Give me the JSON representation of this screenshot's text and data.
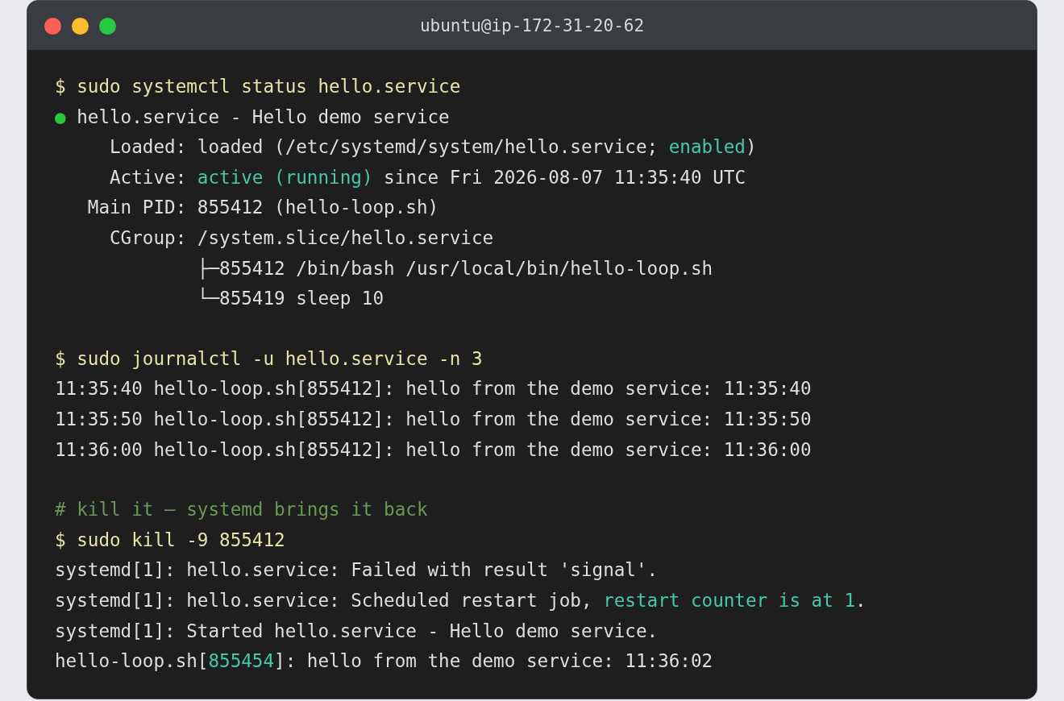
{
  "window": {
    "title": "ubuntu@ip-172-31-20-62",
    "controls": [
      {
        "color": "#ff5f57"
      },
      {
        "color": "#febc2e"
      },
      {
        "color": "#28c840"
      }
    ]
  },
  "blocks": [
    {
      "lines": [
        {
          "segments": [
            {
              "kind": "command",
              "text": "$ sudo systemctl status hello.service"
            }
          ]
        },
        {
          "segments": [
            {
              "kind": "dot",
              "text": "●"
            },
            {
              "kind": "output",
              "text": " hello.service - Hello demo service"
            }
          ]
        },
        {
          "segments": [
            {
              "kind": "output",
              "text": "     Loaded: loaded (/etc/systemd/system/hello.service; "
            },
            {
              "kind": "accent",
              "text": "enabled"
            },
            {
              "kind": "output",
              "text": ")"
            }
          ]
        },
        {
          "segments": [
            {
              "kind": "output",
              "text": "     Active: "
            },
            {
              "kind": "accent",
              "text": "active (running)"
            },
            {
              "kind": "output",
              "text": " since Fri 2026-08-07 11:35:40 UTC"
            }
          ]
        },
        {
          "segments": [
            {
              "kind": "output",
              "text": "   Main PID: 855412 (hello-loop.sh)"
            }
          ]
        },
        {
          "segments": [
            {
              "kind": "output",
              "text": "     CGroup: /system.slice/hello.service"
            }
          ]
        },
        {
          "segments": [
            {
              "kind": "output",
              "text": "             ├─855412 /bin/bash /usr/local/bin/hello-loop.sh"
            }
          ]
        },
        {
          "segments": [
            {
              "kind": "output",
              "text": "             └─855419 sleep 10"
            }
          ]
        }
      ]
    },
    {
      "lines": [
        {
          "segments": [
            {
              "kind": "command",
              "text": "$ sudo journalctl -u hello.service -n 3"
            }
          ]
        },
        {
          "segments": [
            {
              "kind": "output",
              "text": "11:35:40 hello-loop.sh[855412]: hello from the demo service: 11:35:40"
            }
          ]
        },
        {
          "segments": [
            {
              "kind": "output",
              "text": "11:35:50 hello-loop.sh[855412]: hello from the demo service: 11:35:50"
            }
          ]
        },
        {
          "segments": [
            {
              "kind": "output",
              "text": "11:36:00 hello-loop.sh[855412]: hello from the demo service: 11:36:00"
            }
          ]
        }
      ]
    },
    {
      "lines": [
        {
          "segments": [
            {
              "kind": "comment",
              "text": "# kill it — systemd brings it back"
            }
          ]
        },
        {
          "segments": [
            {
              "kind": "command",
              "text": "$ sudo kill -9 855412"
            }
          ]
        },
        {
          "segments": [
            {
              "kind": "output",
              "text": "systemd[1]: hello.service: Failed with result 'signal'."
            }
          ]
        },
        {
          "segments": [
            {
              "kind": "output",
              "text": "systemd[1]: hello.service: Scheduled restart job, "
            },
            {
              "kind": "accent",
              "text": "restart counter is at 1"
            },
            {
              "kind": "output",
              "text": "."
            }
          ]
        },
        {
          "segments": [
            {
              "kind": "output",
              "text": "systemd[1]: Started hello.service - Hello demo service."
            }
          ]
        },
        {
          "segments": [
            {
              "kind": "output",
              "text": "hello-loop.sh["
            },
            {
              "kind": "accent",
              "text": "855454"
            },
            {
              "kind": "output",
              "text": "]: hello from the demo service: 11:36:02"
            }
          ]
        }
      ]
    }
  ]
}
